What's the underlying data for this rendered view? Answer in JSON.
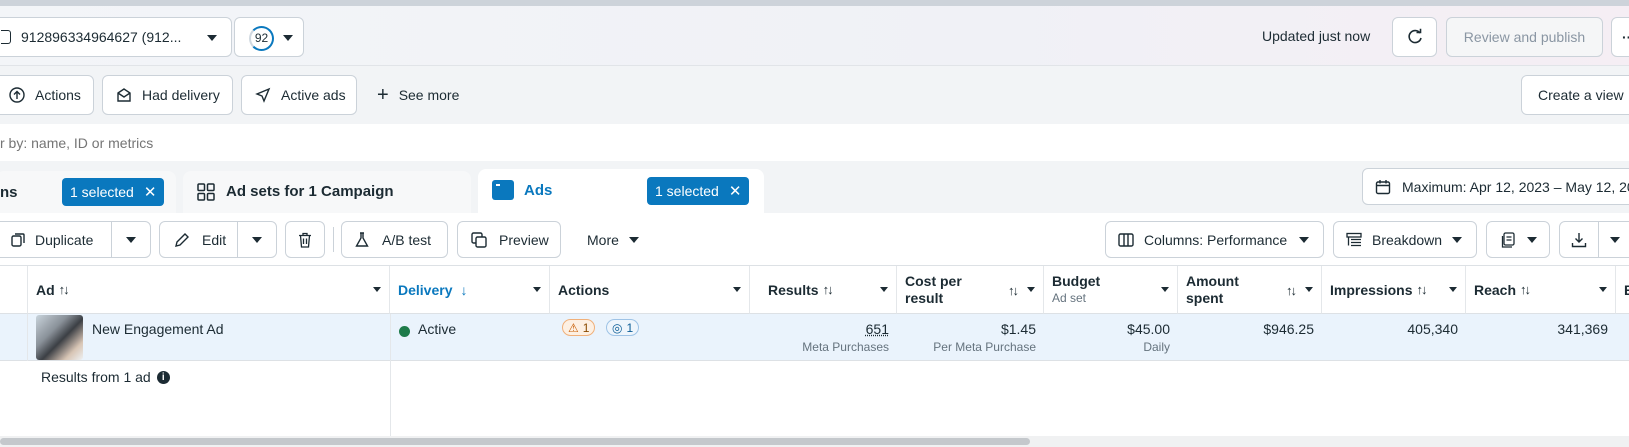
{
  "header": {
    "account_label": "912896334964627 (912...",
    "score": "92",
    "updated_text": "Updated just now",
    "review_publish": "Review and publish",
    "more": "··"
  },
  "filters": {
    "actions": "Actions",
    "had_delivery": "Had delivery",
    "active_ads": "Active ads",
    "see_more": "See more",
    "create_view": "Create a view"
  },
  "search": {
    "placeholder": "r by: name, ID or metrics"
  },
  "tabs": {
    "campaigns_label": "ns",
    "campaigns_selected": "1 selected",
    "adsets_label": "Ad sets for 1 Campaign",
    "ads_label": "Ads",
    "ads_selected": "1 selected",
    "date_range": "Maximum: Apr 12, 2023 – May 12, 20"
  },
  "toolbar": {
    "duplicate": "Duplicate",
    "edit": "Edit",
    "ab_test": "A/B test",
    "preview": "Preview",
    "more": "More",
    "columns": "Columns: Performance",
    "breakdown": "Breakdown"
  },
  "table": {
    "headers": {
      "ad": "Ad",
      "delivery": "Delivery",
      "actions": "Actions",
      "results": "Results",
      "cost_per_result_1": "Cost per",
      "cost_per_result_2": "result",
      "budget": "Budget",
      "budget_sub": "Ad set",
      "amount_spent_1": "Amount",
      "amount_spent_2": "spent",
      "impressions": "Impressions",
      "reach": "Reach",
      "last": "E"
    },
    "row": {
      "ad_name": "New Engagement Ad",
      "delivery": "Active",
      "warn_count": "1",
      "info_count": "1",
      "results": "651",
      "results_sub": "Meta Purchases",
      "cost": "$1.45",
      "cost_sub": "Per Meta Purchase",
      "budget": "$45.00",
      "budget_sub": "Daily",
      "amount_spent": "$946.25",
      "impressions": "405,340",
      "reach": "341,369"
    },
    "summary": "Results from 1 ad"
  },
  "colors": {
    "accent": "#0a78be",
    "active_dot": "#1e7b4a",
    "warn": "#c75b00"
  }
}
